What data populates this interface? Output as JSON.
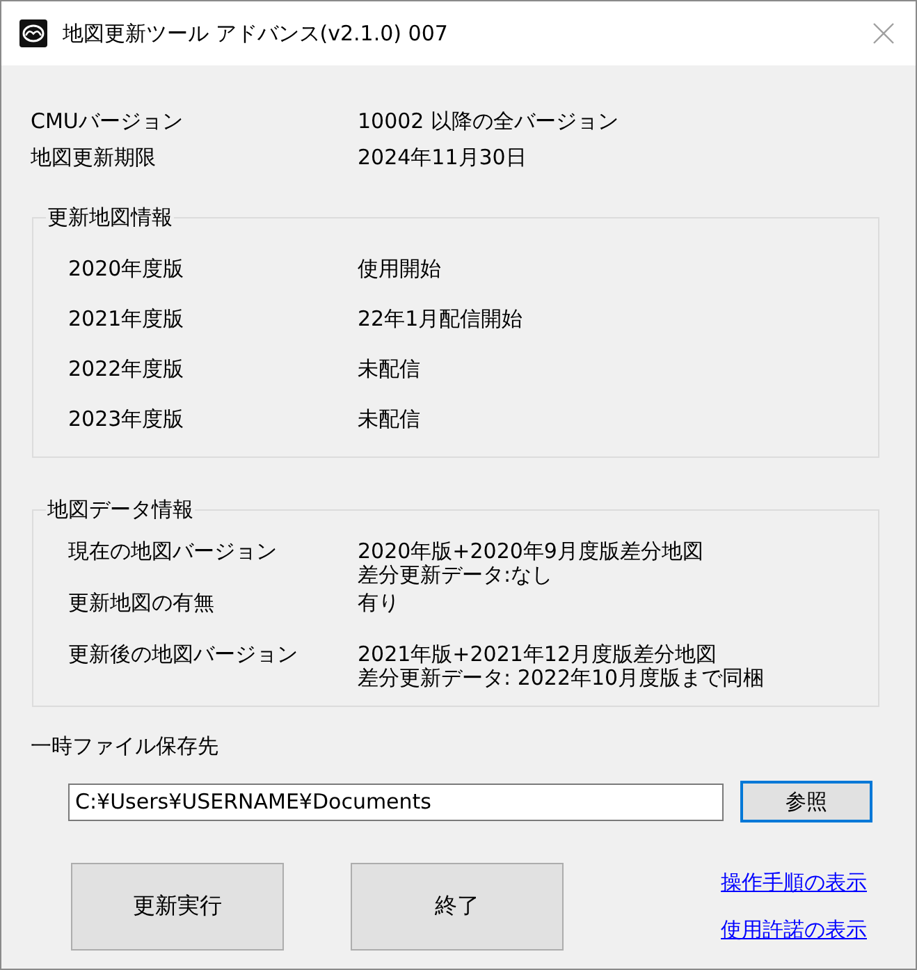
{
  "window": {
    "title": "地図更新ツール アドバンス(v2.1.0) 007"
  },
  "info": [
    {
      "label": "CMUバージョン",
      "value": "10002 以降の全バージョン"
    },
    {
      "label": "地図更新期限",
      "value": "2024年11月30日"
    }
  ],
  "groups": [
    {
      "title": "更新地図情報",
      "rows": [
        {
          "label": "2020年度版",
          "lines": [
            "使用開始"
          ]
        },
        {
          "label": "2021年度版",
          "lines": [
            "22年1月配信開始"
          ]
        },
        {
          "label": "2022年度版",
          "lines": [
            "未配信"
          ]
        },
        {
          "label": "2023年度版",
          "lines": [
            "未配信"
          ]
        }
      ]
    },
    {
      "title": "地図データ情報",
      "rows": [
        {
          "label": "現在の地図バージョン",
          "lines": [
            "2020年版+2020年9月度版差分地図",
            "差分更新データ:なし"
          ]
        },
        {
          "label": "更新地図の有無",
          "lines": [
            "有り"
          ]
        },
        {
          "label": "更新後の地図バージョン",
          "lines": [
            "2021年版+2021年12月度版差分地図",
            "差分更新データ: 2022年10月度版まで同梱"
          ]
        }
      ]
    }
  ],
  "temp_folder": {
    "label": "一時ファイル保存先",
    "value": "C:¥Users¥USERNAME¥Documents",
    "browse_button": {
      "label": "参照",
      "focused": true
    }
  },
  "buttons": [
    "更新実行",
    "終了"
  ],
  "links": [
    "操作手順の表示",
    "使用許諾の表示"
  ]
}
